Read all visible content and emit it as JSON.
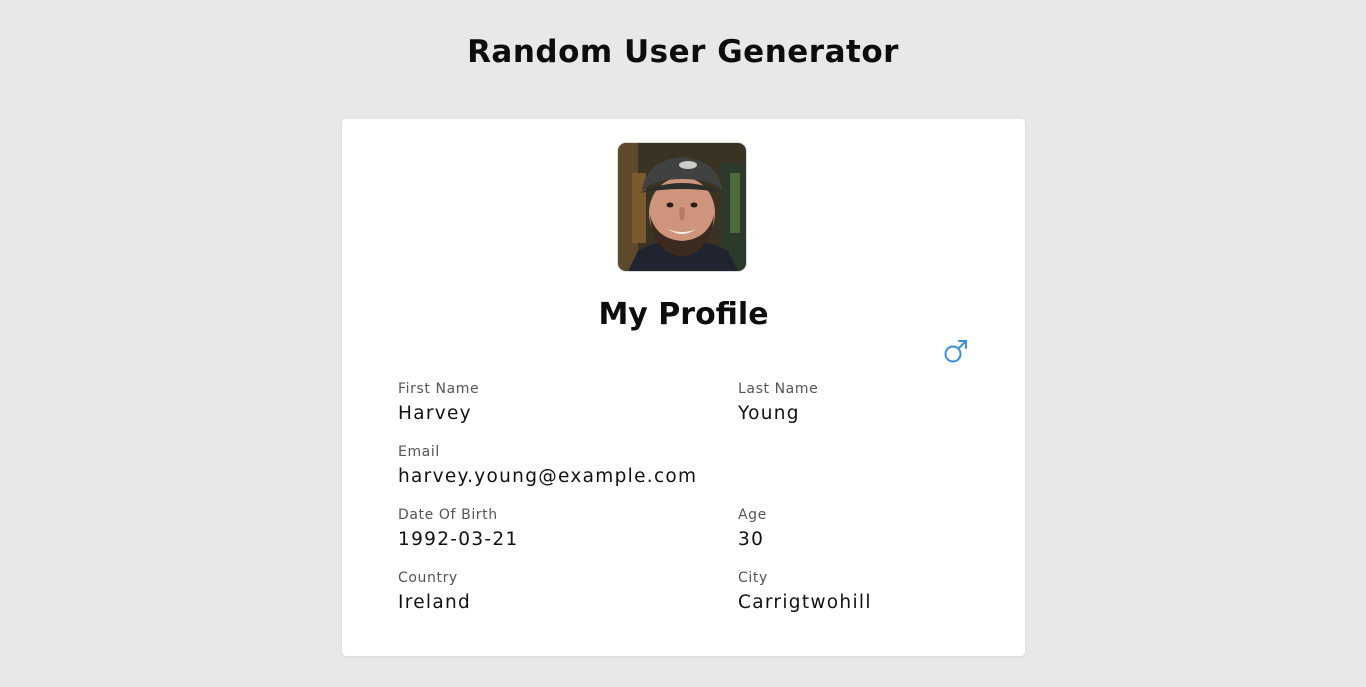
{
  "header": {
    "title": "Random User Generator"
  },
  "profile": {
    "title": "My Profile",
    "avatar_icon": "user-photo",
    "gender_icon": "male-symbol-icon",
    "gender_color": "#3b8fd6",
    "fields": {
      "first_name": {
        "label": "First Name",
        "value": "Harvey"
      },
      "last_name": {
        "label": "Last Name",
        "value": "Young"
      },
      "email": {
        "label": "Email",
        "value": "harvey.young@example.com"
      },
      "dob": {
        "label": "Date Of Birth",
        "value": "1992-03-21"
      },
      "age": {
        "label": "Age",
        "value": "30"
      },
      "country": {
        "label": "Country",
        "value": "Ireland"
      },
      "city": {
        "label": "City",
        "value": "Carrigtwohill"
      }
    }
  }
}
